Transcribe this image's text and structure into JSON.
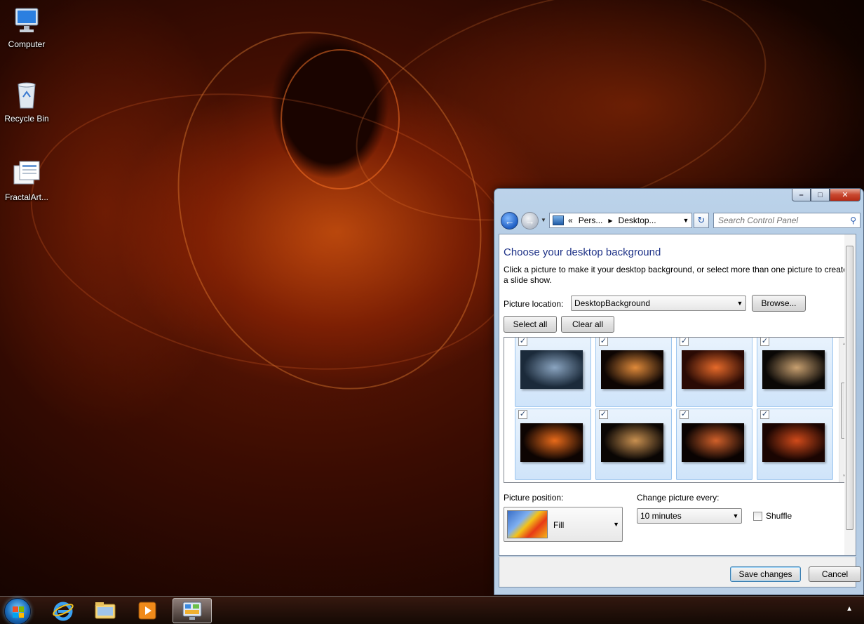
{
  "desktop": {
    "icons": [
      {
        "label": "Computer",
        "icon": "computer-icon"
      },
      {
        "label": "Recycle Bin",
        "icon": "recycle-bin-icon"
      },
      {
        "label": "FractalArt...",
        "icon": "file-shortcut-icon"
      }
    ]
  },
  "window": {
    "caption": {
      "minimize": "–",
      "maximize": "□",
      "close": "✕"
    },
    "address": {
      "prefix": "«",
      "crumbs": [
        "Pers...",
        "Desktop..."
      ]
    },
    "search": {
      "placeholder": "Search Control Panel"
    },
    "title": "Choose your desktop background",
    "description": "Click a picture to make it your desktop background, or select more than one picture to create a slide show.",
    "picture_location": {
      "label": "Picture location:",
      "value": "DesktopBackground"
    },
    "buttons": {
      "browse": "Browse...",
      "select_all": "Select all",
      "clear_all": "Clear all",
      "save": "Save changes",
      "cancel": "Cancel"
    },
    "gallery": {
      "check_mark": "✓",
      "items": [
        {
          "checked": true,
          "colors": [
            "#1b2a3a",
            "#8aa4c0"
          ]
        },
        {
          "checked": true,
          "colors": [
            "#0d0503",
            "#e08a3a"
          ]
        },
        {
          "checked": true,
          "colors": [
            "#2a0a04",
            "#e66a2a"
          ]
        },
        {
          "checked": true,
          "colors": [
            "#0a0806",
            "#c8a070"
          ]
        },
        {
          "checked": true,
          "colors": [
            "#0d0402",
            "#e86a1a"
          ]
        },
        {
          "checked": true,
          "colors": [
            "#0a0604",
            "#c89050"
          ]
        },
        {
          "checked": true,
          "colors": [
            "#0a0302",
            "#d0602a"
          ]
        },
        {
          "checked": true,
          "colors": [
            "#1a0502",
            "#d04a1a"
          ]
        }
      ]
    },
    "picture_position": {
      "label": "Picture position:",
      "value": "Fill"
    },
    "change_picture": {
      "label": "Change picture every:",
      "value": "10 minutes"
    },
    "shuffle": {
      "label": "Shuffle",
      "checked": false
    }
  },
  "taskbar": {
    "items": [
      "start-button",
      "internet-explorer",
      "windows-explorer",
      "media-player",
      "control-panel"
    ],
    "active": "control-panel",
    "tray_arrow": "▲"
  }
}
